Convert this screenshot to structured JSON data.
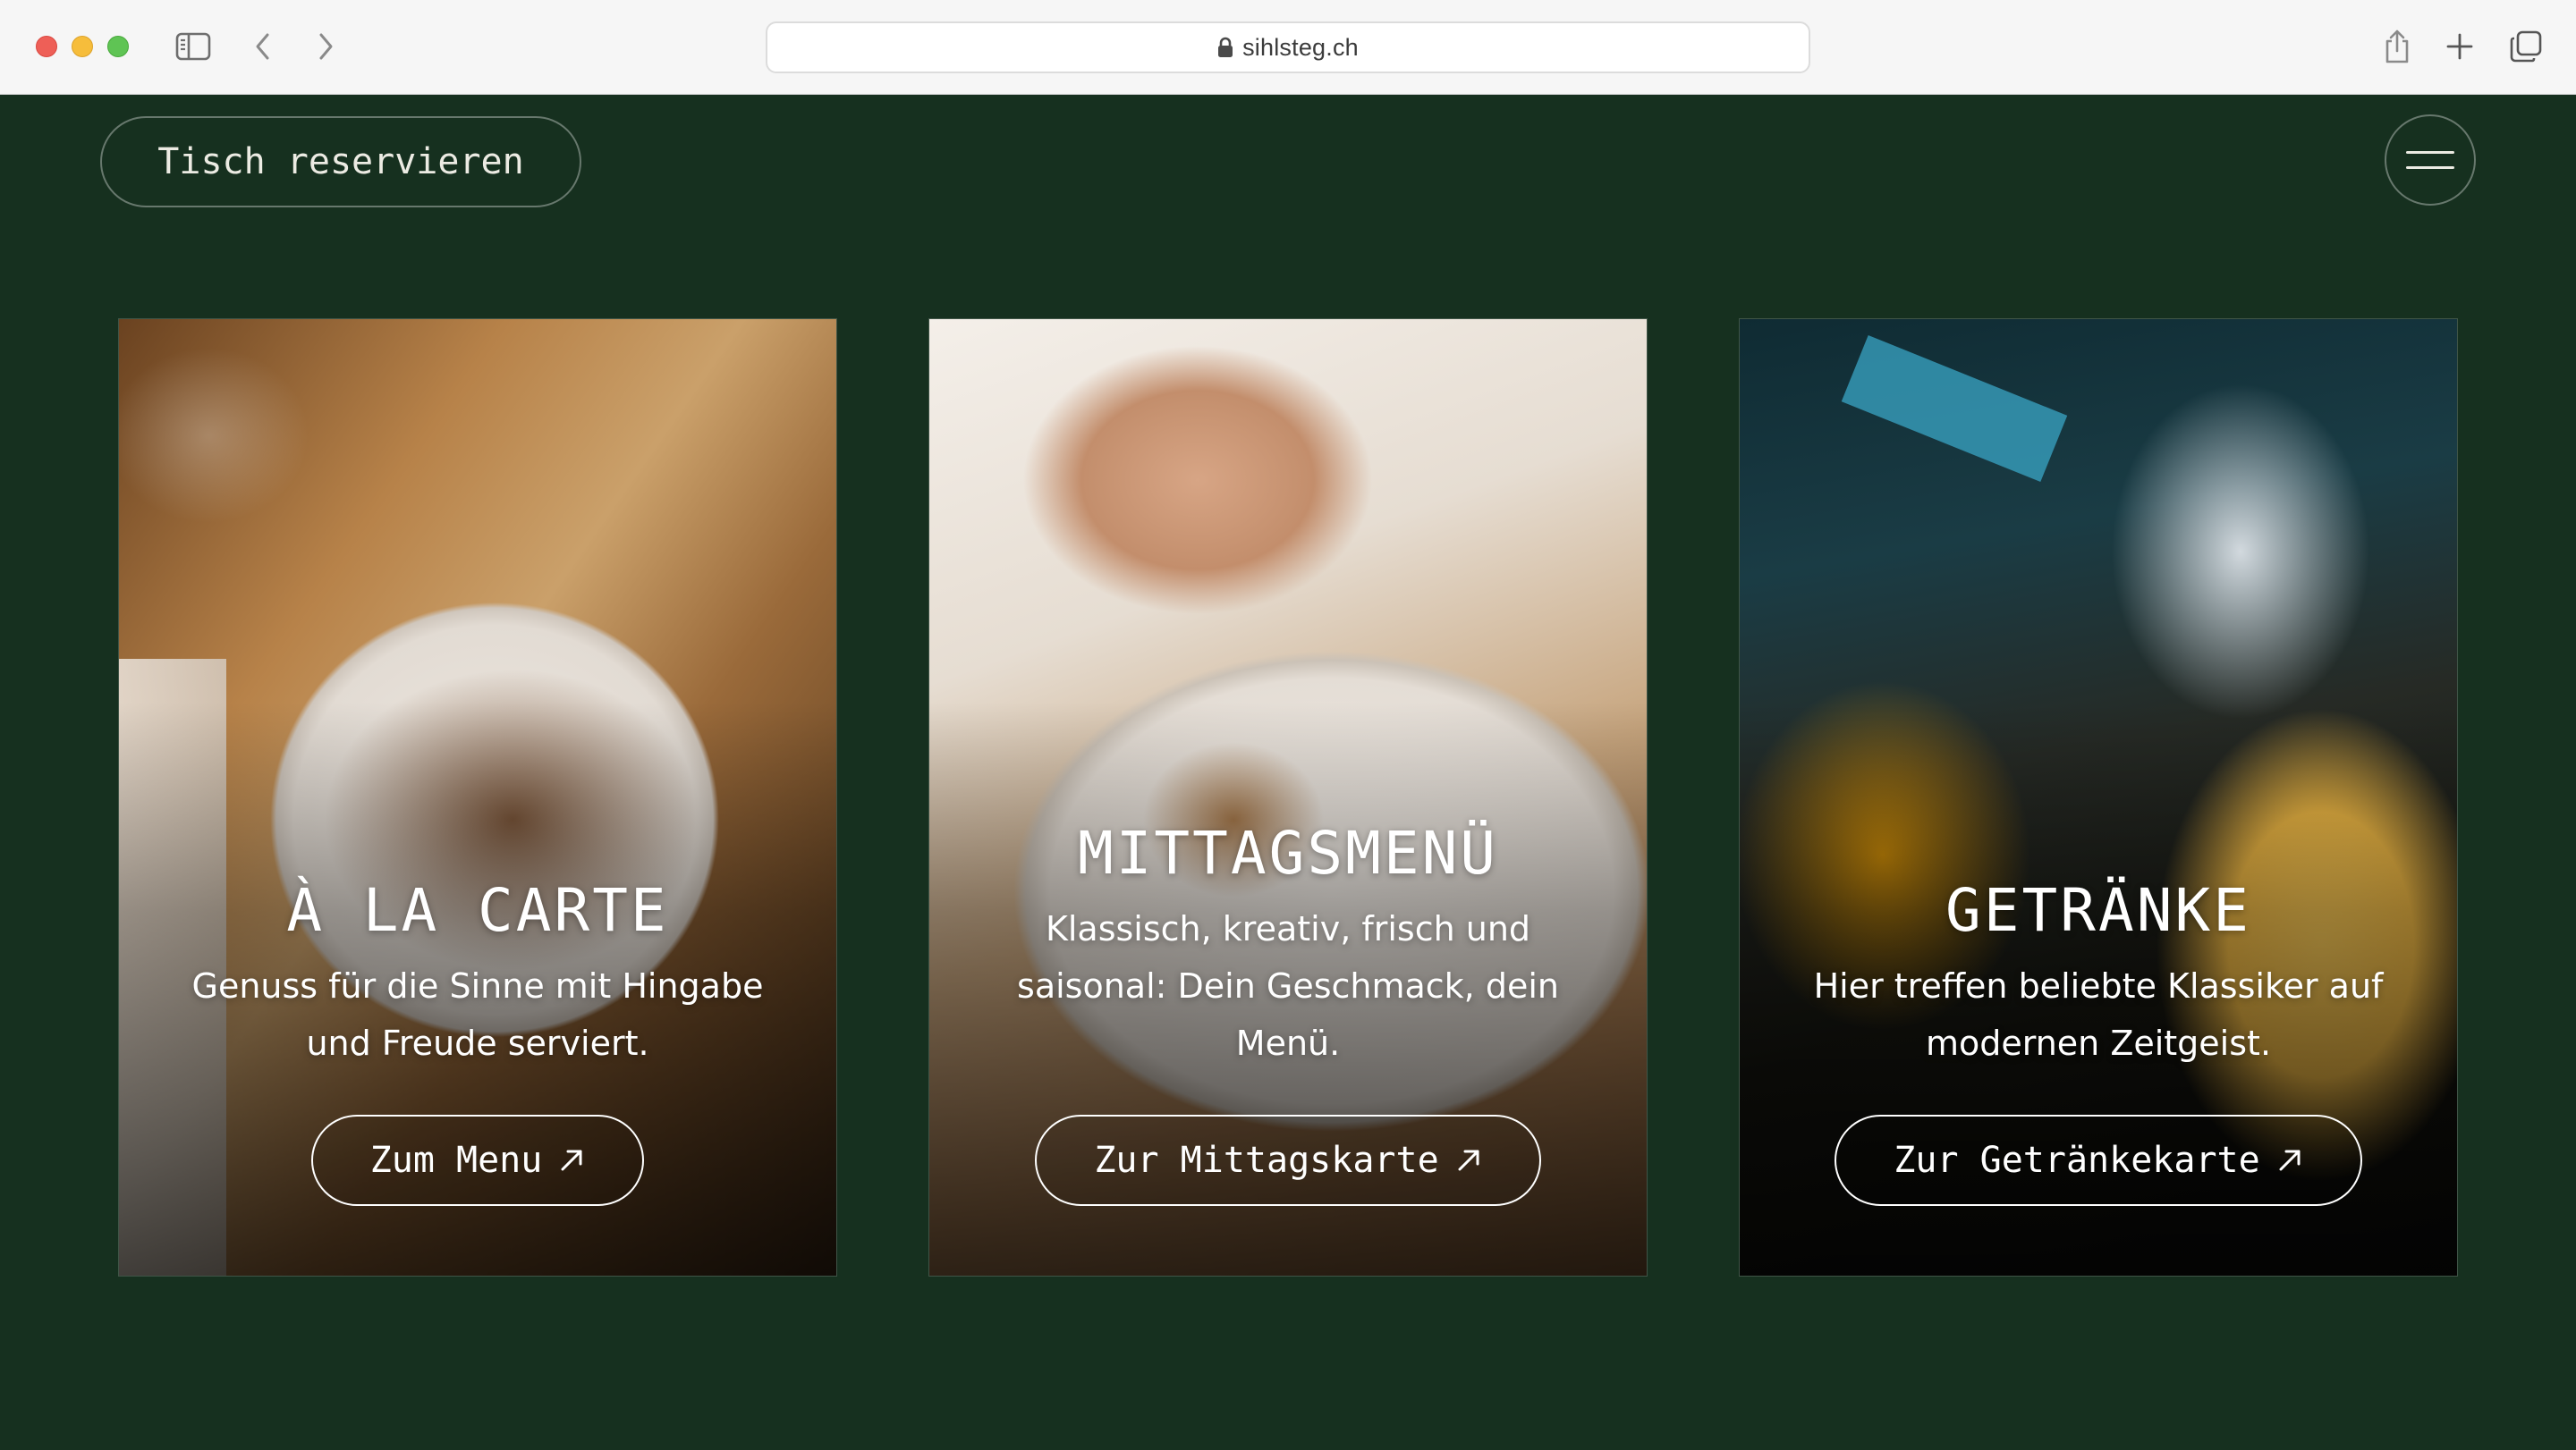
{
  "browser": {
    "url": "sihlsteg.ch"
  },
  "header": {
    "reserve_label": "Tisch reservieren"
  },
  "cards": [
    {
      "title": "À LA CARTE",
      "description": "Genuss für die Sinne mit Hingabe und Freude serviert.",
      "button": "Zum Menu"
    },
    {
      "title": "MITTAGSMENÜ",
      "description": "Klassisch, kreativ, frisch und saisonal: Dein Geschmack, dein Menü.",
      "button": "Zur Mittagskarte"
    },
    {
      "title": "GETRÄNKE",
      "description": "Hier treffen beliebte Klassiker auf modernen Zeitgeist.",
      "button": "Zur Getränkekarte"
    }
  ],
  "colors": {
    "page_background": "#16301f",
    "text": "#ffffff"
  }
}
